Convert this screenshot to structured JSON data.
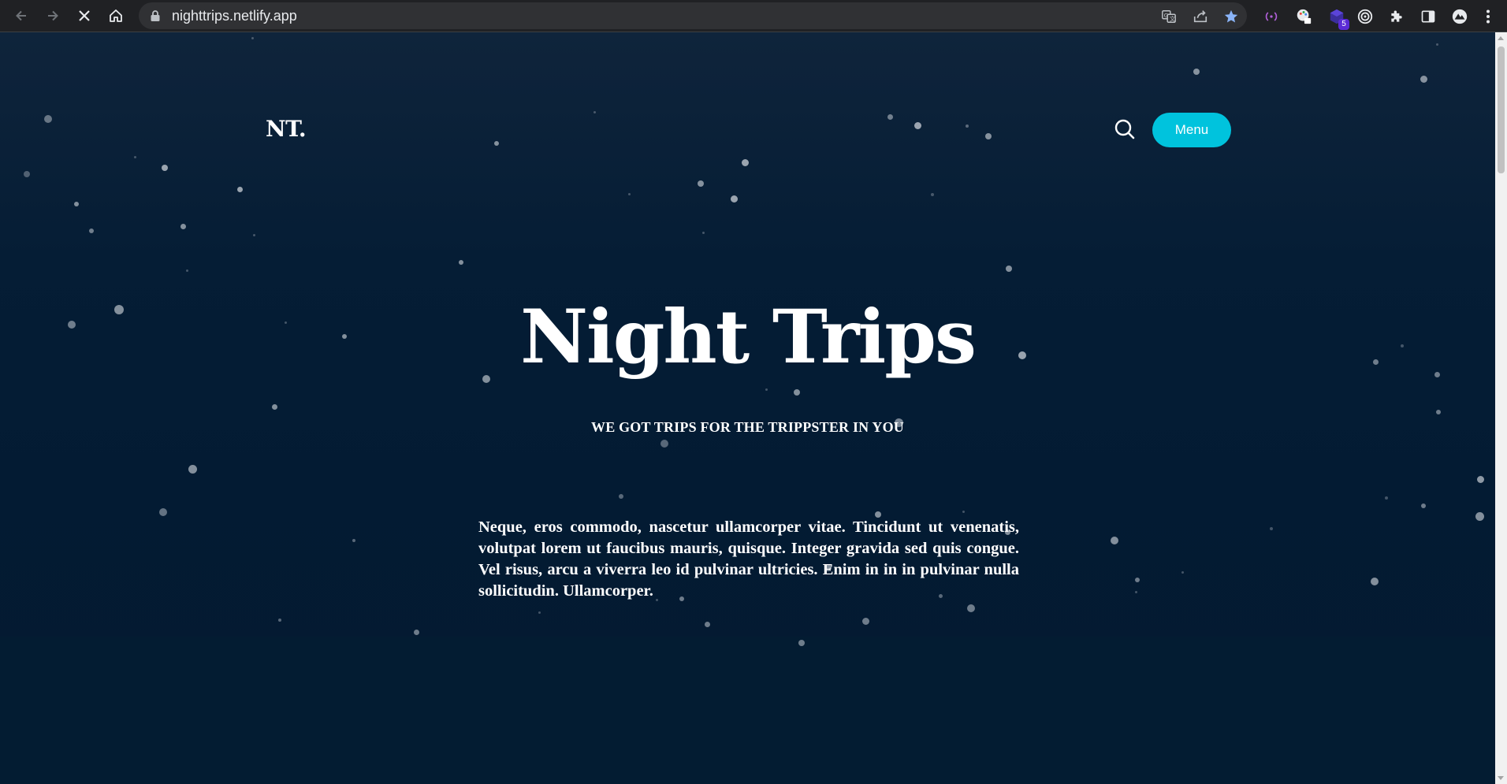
{
  "browser": {
    "url": "nighttrips.netlify.app",
    "extension_badge": "5",
    "icons": {
      "back": "back-arrow-icon",
      "forward": "forward-arrow-icon",
      "stop": "stop-loading-icon",
      "home": "home-icon",
      "lock": "lock-icon",
      "translate": "translate-icon",
      "share": "share-icon",
      "bookmark": "star-bookmark-icon",
      "extensions": "puzzle-icon",
      "sidepanel": "side-panel-icon",
      "menu": "kebab-menu-icon"
    },
    "accent": "#8ab4f8"
  },
  "site": {
    "brand": "NT.",
    "menu_label": "Menu",
    "search_icon": "search-icon",
    "title": "Night Trips",
    "subtitle": "WE GOT TRIPS FOR THE TRIPPSTER IN YOU",
    "body": "Neque, eros commodo, nascetur ullamcorper vitae. Tincidunt ut venenatis, volutpat lorem ut faucibus mauris, quisque. Integer gravida sed quis congue. Vel risus, arcu a viverra leo id pulvinar ultricies. Enim in in in pulvinar nulla sollicitudin. Ullamcorper.",
    "colors": {
      "background": "#031b33",
      "menu_button": "#00c3dd",
      "text": "#ffffff"
    }
  }
}
